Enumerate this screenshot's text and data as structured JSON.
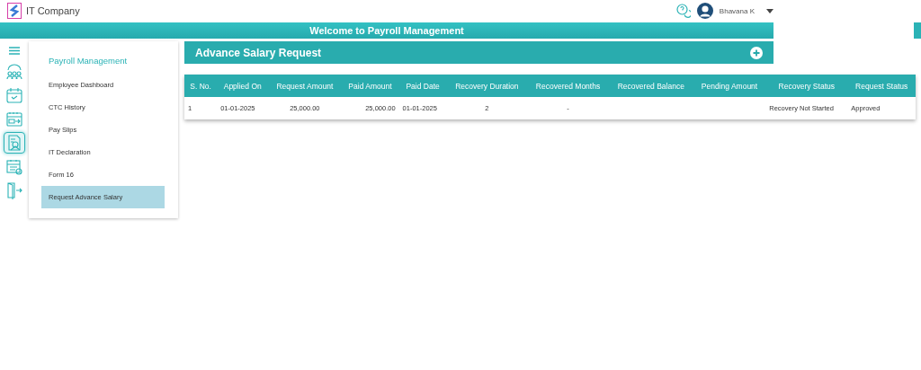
{
  "header": {
    "company": "IT Company",
    "user": "Bhavana K"
  },
  "banner": {
    "title": "Welcome to Payroll Management"
  },
  "nav_icons": [
    {
      "kind": "team",
      "selected": false
    },
    {
      "kind": "calendar-check",
      "selected": false
    },
    {
      "kind": "calendar-arrow",
      "selected": false
    },
    {
      "kind": "document",
      "selected": true
    },
    {
      "kind": "calendar-clock",
      "selected": false
    },
    {
      "kind": "exit",
      "selected": false
    }
  ],
  "sidebar": {
    "title": "Payroll Management",
    "items": [
      {
        "label": "Employee Dashboard",
        "selected": false
      },
      {
        "label": "CTC History",
        "selected": false
      },
      {
        "label": "Pay Slips",
        "selected": false
      },
      {
        "label": "IT Declaration",
        "selected": false
      },
      {
        "label": "Form 16",
        "selected": false
      },
      {
        "label": "Request Advance Salary",
        "selected": true
      }
    ]
  },
  "panel": {
    "title": "Advance Salary Request"
  },
  "table": {
    "columns": [
      "S. No.",
      "Applied On",
      "Request Amount",
      "Paid Amount",
      "Paid Date",
      "Recovery Duration",
      "Recovered Months",
      "Recovered Balance",
      "Pending Amount",
      "Recovery Status",
      "Request Status"
    ],
    "rows": [
      [
        "1",
        "01-01-2025",
        "25,000.00",
        "25,000.00",
        "01-01-2025",
        "2",
        "-",
        "",
        "",
        "Recovery Not Started",
        "Approved"
      ]
    ]
  }
}
